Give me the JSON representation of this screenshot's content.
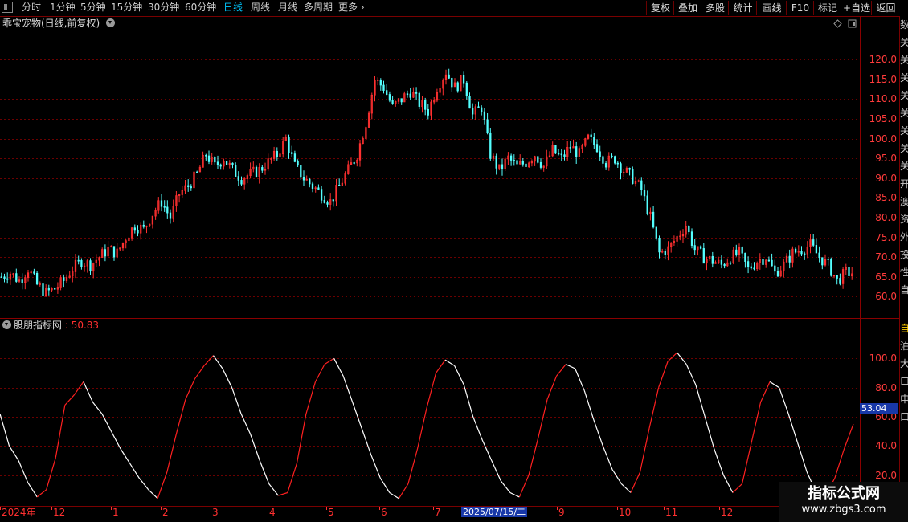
{
  "periods": [
    {
      "label": "分时",
      "active": false
    },
    {
      "label": "1分钟",
      "active": false
    },
    {
      "label": "5分钟",
      "active": false
    },
    {
      "label": "15分钟",
      "active": false
    },
    {
      "label": "30分钟",
      "active": false
    },
    {
      "label": "60分钟",
      "active": false
    },
    {
      "label": "日线",
      "active": true
    },
    {
      "label": "周线",
      "active": false
    },
    {
      "label": "月线",
      "active": false
    },
    {
      "label": "多周期",
      "active": false
    },
    {
      "label": "更多",
      "active": false
    }
  ],
  "tools": [
    "复权",
    "叠加",
    "多股",
    "统计",
    "画线",
    "F10",
    "标记",
    "+自选",
    "返回"
  ],
  "main_panel": {
    "title": "乖宝宠物(日线,前复权)"
  },
  "indicator_panel": {
    "title": "股朋指标网",
    "value_sep": " : ",
    "value": "50.83"
  },
  "right_strip": {
    "top_chars": [
      "数",
      "关",
      "关",
      "关",
      "关",
      "关",
      "关",
      "关",
      "关",
      "开",
      "澳",
      "资",
      "外",
      "投",
      "性",
      "自"
    ],
    "lower_chars": [
      "自",
      "泊",
      "大",
      "口",
      "申",
      "口"
    ]
  },
  "current_value_badge": "53.04",
  "x_axis": {
    "labels": [
      "2024年",
      "12",
      "1",
      "2",
      "3",
      "4",
      "5",
      "6",
      "7",
      "8",
      "9",
      "10",
      "11",
      "12"
    ],
    "cursor_date": "2025/07/15/二"
  },
  "watermark": {
    "title": "指标公式网",
    "url": "www.zbgs3.com"
  },
  "chart_data": [
    {
      "type": "candlestick",
      "title": "乖宝宠物(日线,前复权)",
      "ylim": [
        57,
        128
      ],
      "y_ticks": [
        60.0,
        65.0,
        70.0,
        75.0,
        80.0,
        85.0,
        90.0,
        95.0,
        100.0,
        105.0,
        110.0,
        115.0,
        120.0
      ],
      "grid": true,
      "up_color": "#ff3030",
      "down_color": "#54ffff",
      "closes_approx": [
        65,
        66,
        64,
        67,
        63,
        61,
        62,
        64,
        67,
        69,
        68,
        70,
        72,
        71,
        75,
        78,
        77,
        81,
        84,
        80,
        86,
        88,
        91,
        96,
        93,
        95,
        92,
        90,
        91,
        92,
        94,
        96,
        100,
        93,
        90,
        88,
        86,
        84,
        88,
        92,
        96,
        104,
        115,
        113,
        108,
        110,
        112,
        109,
        107,
        113,
        117,
        113,
        115,
        106,
        108,
        96,
        92,
        95,
        93,
        94,
        96,
        93,
        97,
        95,
        98,
        96,
        100,
        98,
        94,
        95,
        92,
        90,
        87,
        80,
        71,
        72,
        75,
        78,
        72,
        70,
        69,
        68,
        70,
        71,
        67,
        69,
        70,
        66,
        68,
        71,
        72,
        73,
        70,
        68,
        64,
        66
      ],
      "high_low_approx": {
        "max": 124,
        "min": 59
      }
    },
    {
      "type": "line",
      "title": "股朋指标网",
      "ylim": [
        0,
        120
      ],
      "y_ticks": [
        20.0,
        40.0,
        60.0,
        80.0,
        100.0
      ],
      "grid": true,
      "last_value": 50.83,
      "current_cursor_value": 53.04,
      "series": [
        {
          "color": "#ff3030",
          "values": [
            62,
            40,
            30,
            15,
            5,
            10,
            32,
            68,
            75,
            84,
            70,
            62,
            50,
            38,
            28,
            18,
            10,
            4,
            22,
            48,
            72,
            86,
            95,
            102,
            93,
            80,
            62,
            48,
            30,
            14,
            6,
            8,
            28,
            62,
            84,
            96,
            100,
            88,
            70,
            52,
            34,
            18,
            8,
            4,
            14,
            38,
            66,
            90,
            99,
            95,
            82,
            60,
            44,
            30,
            16,
            8,
            5,
            20,
            45,
            72,
            88,
            96,
            93,
            78,
            58,
            40,
            24,
            14,
            8,
            22,
            52,
            80,
            98,
            104,
            96,
            82,
            60,
            38,
            20,
            8,
            14,
            42,
            70,
            84,
            80,
            62,
            42,
            22,
            8,
            6,
            18,
            38,
            55
          ]
        }
      ]
    }
  ]
}
